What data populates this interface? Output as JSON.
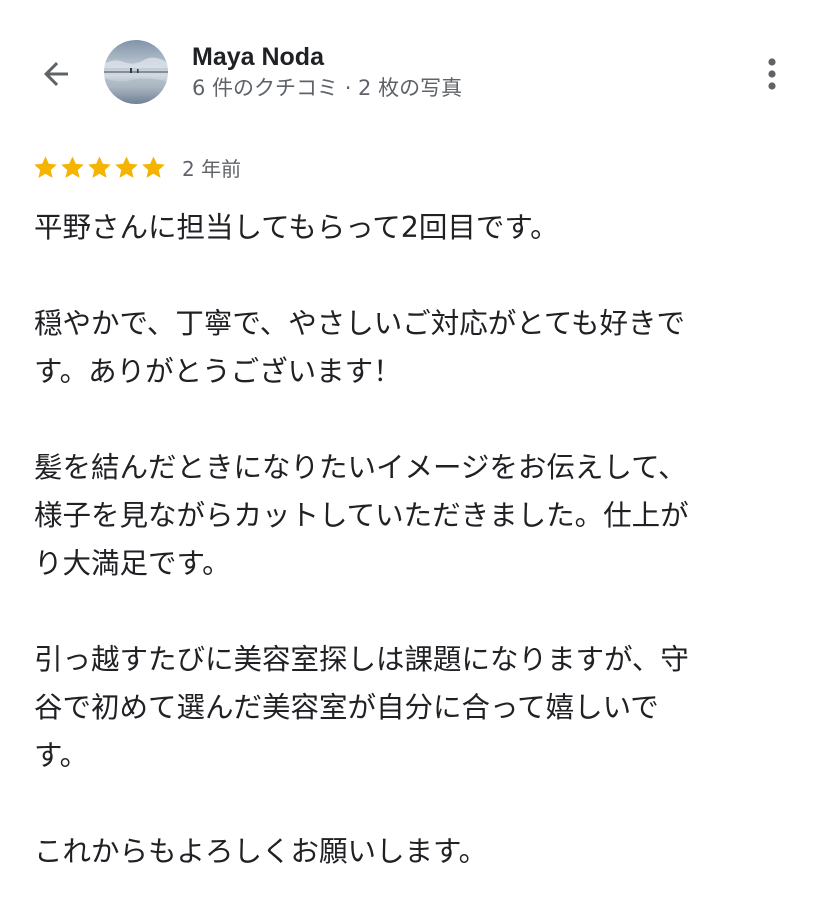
{
  "header": {
    "back_icon": "arrow-back-icon",
    "reviewer_name": "Maya Noda",
    "reviewer_meta": "6 件のクチコミ · 2 枚の写真",
    "more_icon": "more-vertical-icon"
  },
  "review": {
    "rating": 5,
    "rating_max": 5,
    "star_color": "#f4b400",
    "date": "2 年前",
    "paragraphs": [
      {
        "lines": [
          "平野さんに担当してもらって2回目です。"
        ]
      },
      {
        "lines": [
          "穏やかで、丁寧で、やさしいご対応がとても好きで",
          "す。ありがとうございます！"
        ]
      },
      {
        "lines": [
          "髪を結んだときになりたいイメージをお伝えして、",
          "様子を見ながらカットしていただきました。仕上が",
          "り大満足です。"
        ]
      },
      {
        "lines": [
          "引っ越すたびに美容室探しは課題になりますが、守",
          "谷で初めて選んだ美容室が自分に合って嬉しいで",
          "す。"
        ]
      },
      {
        "lines": [
          "これからもよろしくお願いします。"
        ]
      }
    ]
  },
  "colors": {
    "text_primary": "#202124",
    "text_secondary": "#5f6368",
    "background": "#ffffff"
  }
}
